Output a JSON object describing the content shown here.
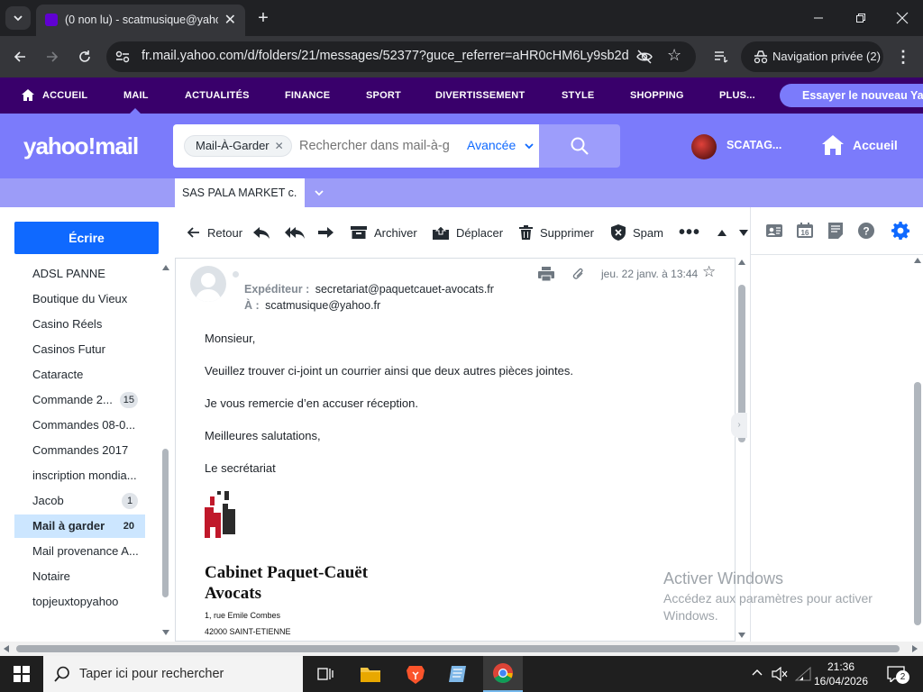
{
  "browser": {
    "tab_title": "(0 non lu) - scatmusique@yaho",
    "url": "fr.mail.yahoo.com/d/folders/21/messages/52377?guce_referrer=aHR0cHM6Ly9sb2dp...",
    "private_label": "Navigation privée (2)"
  },
  "yahoo_nav": {
    "items": [
      "ACCUEIL",
      "MAIL",
      "ACTUALITÉS",
      "FINANCE",
      "SPORT",
      "DIVERTISSEMENT",
      "STYLE",
      "SHOPPING",
      "PLUS..."
    ],
    "try_new": "Essayer le nouveau Yah"
  },
  "header": {
    "logo": "yahoo!mail",
    "search_chip": "Mail-À-Garder",
    "search_placeholder": "Rechercher dans mail-à-g",
    "advanced_label": "Avancée",
    "user_name": "SCATAG...",
    "home_label": "Accueil"
  },
  "subheader": {
    "open_tab": "SAS PALA MARKET c."
  },
  "sidebar": {
    "compose_label": "Écrire",
    "folders": [
      {
        "name": "ADSL PANNE",
        "count": ""
      },
      {
        "name": "Boutique du Vieux",
        "count": ""
      },
      {
        "name": "Casino Réels",
        "count": ""
      },
      {
        "name": "Casinos Futur",
        "count": ""
      },
      {
        "name": "Cataracte",
        "count": ""
      },
      {
        "name": "Commande 2...",
        "count": "15"
      },
      {
        "name": "Commandes 08-0...",
        "count": ""
      },
      {
        "name": "Commandes 2017",
        "count": ""
      },
      {
        "name": "inscription mondia...",
        "count": ""
      },
      {
        "name": "Jacob",
        "count": "1"
      },
      {
        "name": "Mail à garder",
        "count": "20"
      },
      {
        "name": "Mail provenance A...",
        "count": ""
      },
      {
        "name": "Notaire",
        "count": ""
      },
      {
        "name": "topjeuxtopyahoo",
        "count": ""
      }
    ]
  },
  "toolbar": {
    "back": "Retour",
    "archive": "Archiver",
    "move": "Déplacer",
    "delete": "Supprimer",
    "spam": "Spam"
  },
  "message": {
    "date": "jeu. 22 janv. à 13:44",
    "from_label": "Expéditeur :",
    "from_value": "secretariat@paquetcauet-avocats.fr",
    "to_label": "À :",
    "to_value": "scatmusique@yahoo.fr",
    "body": [
      "Monsieur,",
      "Veuillez trouver ci-joint un courrier ainsi que deux autres pièces jointes.",
      "Je vous remercie d’en accuser réception.",
      "Meilleures salutations,",
      "Le secrétariat"
    ],
    "firm_line1": "Cabinet Paquet-Cauët",
    "firm_line2": "Avocats",
    "address1": "1, rue Emile Combes",
    "address2": "42000 SAINT-ETIENNE"
  },
  "watermark": {
    "title": "Activer Windows",
    "line1": "Accédez aux paramètres pour activer",
    "line2": "Windows."
  },
  "taskbar": {
    "search_placeholder": "Taper ici pour rechercher",
    "time": "21:36",
    "date": "16/04/2026",
    "notif_count": "2"
  },
  "colors": {
    "yahoo_purple_dark": "#39006b",
    "mail_header": "#7b7bfb",
    "accent_blue": "#0f69ff",
    "selected_folder": "#cce6ff"
  }
}
